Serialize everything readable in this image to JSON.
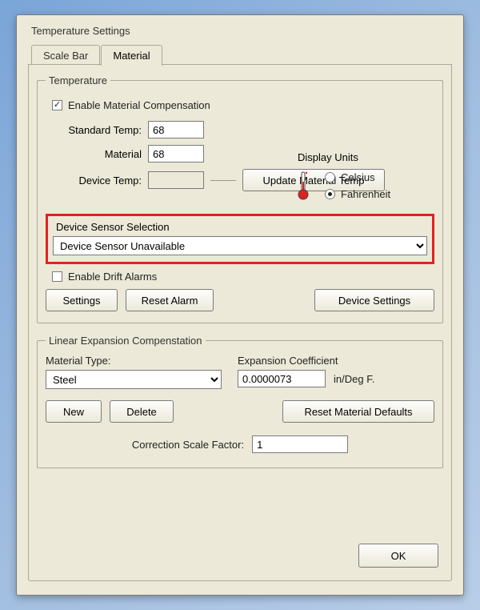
{
  "window": {
    "title": "Temperature Settings"
  },
  "tabs": {
    "scale_bar": "Scale Bar",
    "material": "Material"
  },
  "temperature": {
    "legend": "Temperature",
    "enable_material_comp": "Enable Material Compensation",
    "standard_temp_label": "Standard Temp:",
    "standard_temp_value": "68",
    "material_label": "Material",
    "material_value": "68",
    "device_temp_label": "Device Temp:",
    "device_temp_value": "",
    "update_material_temp": "Update Material Temp",
    "display_units_label": "Display Units",
    "celsius": "Celsius",
    "fahrenheit": "Fahrenheit",
    "sensor_legend": "Device Sensor Selection",
    "sensor_value": "Device Sensor Unavailable",
    "enable_drift_alarms": "Enable Drift Alarms",
    "settings_btn": "Settings",
    "reset_alarm_btn": "Reset Alarm",
    "device_settings_btn": "Device Settings"
  },
  "linear": {
    "legend": "Linear Expansion Compenstation",
    "material_type_label": "Material Type:",
    "material_type_value": "Steel",
    "expansion_coef_label": "Expansion Coefficient",
    "expansion_coef_value": "0.0000073",
    "expansion_coef_units": "in/Deg F.",
    "new_btn": "New",
    "delete_btn": "Delete",
    "reset_defaults_btn": "Reset Material Defaults",
    "correction_label": "Correction Scale Factor:",
    "correction_value": "1"
  },
  "ok": "OK"
}
